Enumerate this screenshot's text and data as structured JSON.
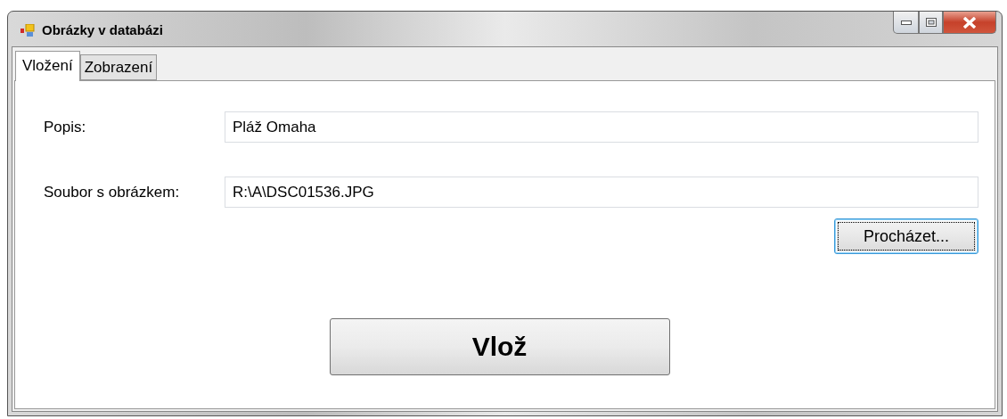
{
  "window": {
    "title": "Obrázky v databázi"
  },
  "tabs": [
    {
      "label": "Vložení",
      "selected": true
    },
    {
      "label": "Zobrazení",
      "selected": false
    }
  ],
  "form": {
    "fields": [
      {
        "label": "Popis:",
        "value": "Pláž Omaha"
      },
      {
        "label": "Soubor s obrázkem:",
        "value": "R:\\A\\DSC01536.JPG"
      }
    ],
    "browse_button": {
      "label": "Procházet...",
      "focused": true
    },
    "insert_button": {
      "label": "Vlož"
    }
  }
}
